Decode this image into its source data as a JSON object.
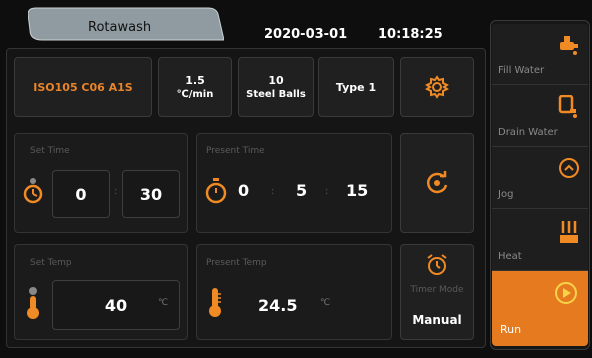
{
  "header": {
    "tab_label": "Rotawash",
    "date": "2020-03-01",
    "time": "10:18:25"
  },
  "params": {
    "standard": "ISO105 C06 A1S",
    "speed_value": "1.5",
    "speed_unit": "℃/min",
    "balls_value": "10",
    "balls_unit": "Steel Balls",
    "type": "Type 1"
  },
  "set_time": {
    "label": "Set Time",
    "minutes": "0",
    "seconds": "30"
  },
  "present_time": {
    "label": "Present Time",
    "hours": "0",
    "minutes": "5",
    "seconds": "15"
  },
  "set_temp": {
    "label": "Set Temp",
    "value": "40",
    "unit": "℃"
  },
  "present_temp": {
    "label": "Present Temp",
    "value": "24.5",
    "unit": "℃"
  },
  "timer_mode": {
    "label": "Timer Mode",
    "value": "Manual"
  },
  "sidebar": {
    "fill_water": "Fill Water",
    "drain_water": "Drain Water",
    "jog": "Jog",
    "heat": "Heat",
    "run": "Run"
  },
  "colors": {
    "accent": "#e8842a",
    "run_bg": "#e57b1e",
    "icon_orange": "#f08a24"
  }
}
